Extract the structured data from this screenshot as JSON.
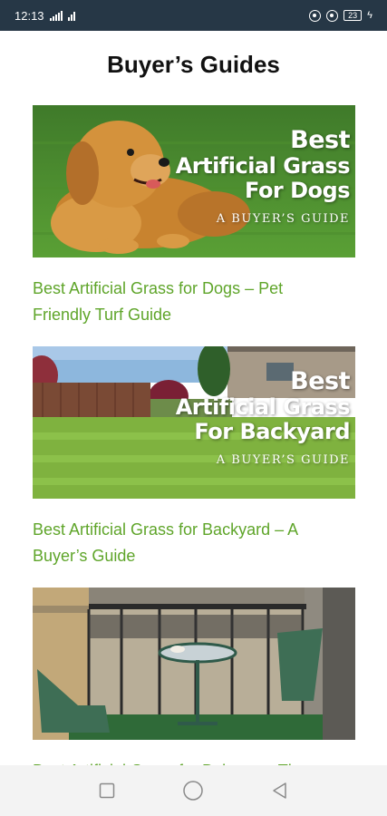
{
  "status_bar": {
    "time": "12:13",
    "battery": "23"
  },
  "page": {
    "title": "Buyer’s Guides"
  },
  "articles": [
    {
      "title": "Best Artificial Grass for Dogs – Pet Friendly Turf Guide",
      "image_overlay": {
        "line1": "Best",
        "line2": "Artificial Grass",
        "line3": "For Dogs",
        "subtitle": "A BUYER’S GUIDE"
      }
    },
    {
      "title": "Best Artificial Grass for Backyard – A Buyer’s Guide",
      "image_overlay": {
        "line1": "Best",
        "line2": "Artificial Grass",
        "line3": "For Backyard",
        "subtitle": "A BUYER’S GUIDE"
      }
    },
    {
      "title": "Best Artificial Grass for Balcony – The"
    }
  ],
  "nav_bar": {
    "icons": [
      "recents-square-icon",
      "home-circle-icon",
      "back-triangle-icon"
    ]
  },
  "colors": {
    "status_bar_bg": "#263746",
    "link_green": "#5fa52a",
    "nav_bar_bg": "#f3f3f3"
  }
}
